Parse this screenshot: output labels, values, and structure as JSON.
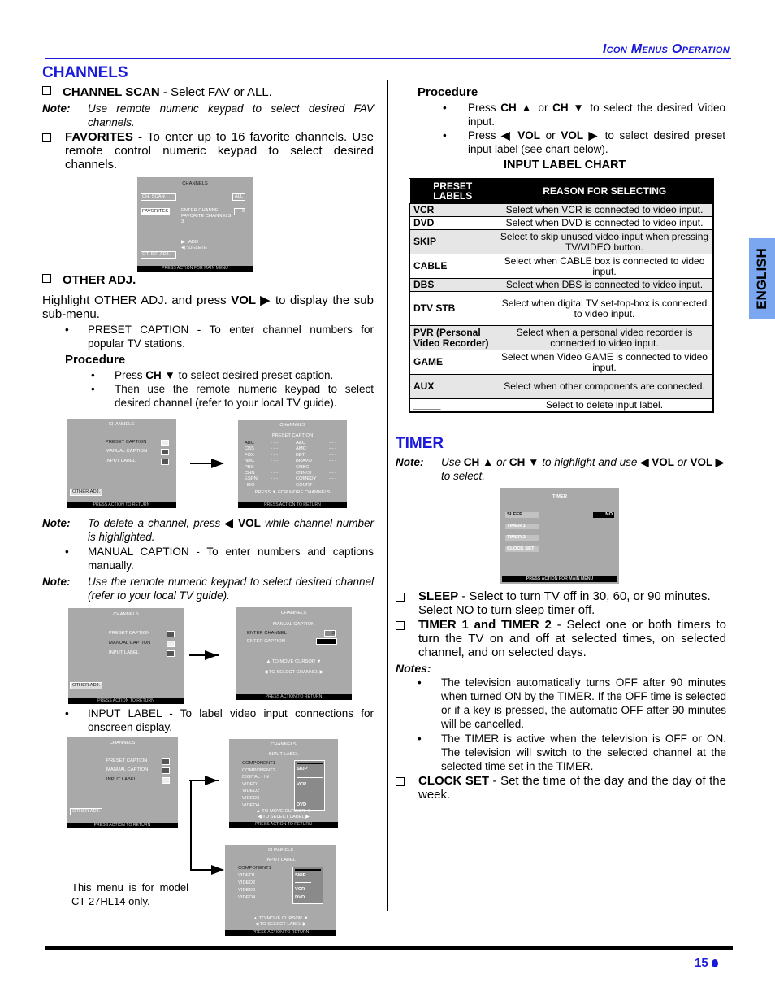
{
  "header": {
    "title": "Icon Menus Operation",
    "side_tab": "ENGLISH"
  },
  "footer": {
    "page_number": "15"
  },
  "channels": {
    "title": "CHANNELS",
    "channel_scan": {
      "label": "CHANNEL SCAN",
      "text": " - Select FAV or ALL."
    },
    "note1": {
      "label": "Note:",
      "text": "Use remote numeric keypad to select desired FAV channels."
    },
    "favorites": {
      "label": "FAVORITES -",
      "text": " To enter up to 16 favorite channels. Use remote control numeric keypad to select desired channels."
    },
    "fav_screen": {
      "title": "CHANNELS",
      "items": [
        "CH. SCAN",
        "FAVORITES",
        "OTHER ADJ."
      ],
      "scan_value": "ALL",
      "enter_channel": "ENTER CHANNEL",
      "enter_value": "3",
      "favorite_channels": "FAVORITE CHANNELS",
      "favorite_value": "3",
      "add": "▶ : ADD",
      "delete": "◀ : DELETE",
      "footer": "PRESS ACTION FOR MAIN MENU"
    },
    "other_adj": {
      "label": "OTHER ADJ.",
      "intro_a": "Highlight OTHER ADJ. and press ",
      "intro_b": "VOL ▶",
      "intro_c": " to display the sub sub-menu.",
      "preset_bullet": "PRESET CAPTION - To enter channel numbers for popular TV stations.",
      "procedure_title": "Procedure",
      "procedure_1a": "Press ",
      "procedure_1b": "CH ▼",
      "procedure_1c": " to select desired preset caption.",
      "procedure_2": "Then use the remote numeric keypad to select desired channel (refer to your local TV guide)."
    },
    "submenu_screen": {
      "title": "CHANNELS",
      "items": [
        "PRESET CAPTION",
        "MANUAL CAPTION",
        "INPUT LABEL"
      ],
      "other_adj": "OTHER ADJ.",
      "footer": "PRESS ACTION TO RETURN"
    },
    "preset_screen": {
      "title": "CHANNELS",
      "subtitle": "PRESET CAPTION",
      "left": [
        "ABC",
        "CBS",
        "FOX",
        "NBC",
        "PBS",
        "CNN",
        "ESPN",
        "HBO"
      ],
      "right": [
        "A&C",
        "AMC",
        "BET",
        "BRAVO",
        "CNBC",
        "CNN/SI",
        "COMEDY",
        "COURT"
      ],
      "dash": "- - -",
      "more": "PRESS ▼ FOR MORE CHANNELS",
      "footer": "PRESS ACTION TO RETURN"
    },
    "note2": {
      "label": "Note:",
      "a": "To delete a channel, press ",
      "b": "◀ VOL",
      "c": " while channel number is highlighted."
    },
    "manual_bullet": "MANUAL CAPTION - To enter numbers and captions manually.",
    "note3": {
      "label": "Note:",
      "text": "Use the remote numeric keypad to select desired channel (refer to your local TV guide)."
    },
    "manual_screen": {
      "title": "CHANNELS",
      "subtitle": "MANUAL CAPTION",
      "enter_channel": "ENTER CHANNEL",
      "channel_value": "3",
      "enter_caption": "ENTER CAPTION",
      "caption_value": "- - - -",
      "move": "▲ TO MOVE CURSOR ▼",
      "select": "◀ TO SELECT CHANNEL ▶",
      "footer": "PRESS ACTION TO RETURN"
    },
    "input_bullet": "INPUT LABEL - To label video input connections for onscreen display.",
    "input_screen": {
      "title": "CHANNELS",
      "subtitle": "INPUT LABEL",
      "inputs": [
        "COMPONENT1",
        "COMPONENT2",
        "DIGITAL - IN",
        "VIDEO1",
        "VIDEO2",
        "VIDEO3",
        "VIDEO4"
      ],
      "options": [
        "SKIP",
        "VCR",
        "DVD"
      ],
      "move": "▲ TO MOVE CURSOR ▼",
      "select": "◀ TO SELECT LABEL ▶",
      "footer": "PRESS ACTION TO RETURN"
    },
    "model_screen": {
      "title": "CHANNELS",
      "subtitle": "INPUT LABEL",
      "inputs": [
        "COMPONENT1",
        "VIDEO1",
        "VIDEO2",
        "VIDEO3",
        "VIDEO4"
      ],
      "options": [
        "SKIP",
        "VCR",
        "DVD"
      ],
      "move": "▲ TO MOVE CURSOR ▼",
      "select": "◀ TO SELECT LABEL ▶",
      "footer": "PRESS ACTION TO RETURN"
    },
    "model_note": "This menu is for model CT-27HL14 only."
  },
  "right": {
    "procedure_title": "Procedure",
    "p1a": "Press ",
    "p1b": "CH ▲",
    "p1c": " or ",
    "p1d": "CH ▼",
    "p1e": " to select the desired Video input.",
    "p2a": "Press ",
    "p2b": "◀ VOL",
    "p2c": " or ",
    "p2d": "VOL ▶",
    "p2e": " to select desired preset input label (see chart below).",
    "chart_title": "INPUT LABEL CHART",
    "chart": {
      "headers": [
        "PRESET LABELS",
        "REASON FOR SELECTING"
      ],
      "rows": [
        {
          "label": "VCR",
          "reason": "Select when VCR is connected to video input."
        },
        {
          "label": "DVD",
          "reason": "Select when DVD is connected to video input."
        },
        {
          "label": "SKIP",
          "reason": "Select to skip unused video input when pressing TV/VIDEO button."
        },
        {
          "label": "CABLE",
          "reason": "Select when CABLE box is connected to video input."
        },
        {
          "label": "DBS",
          "reason": "Select when DBS is connected to video input."
        },
        {
          "label": "DTV STB",
          "reason": "Select when digital TV set-top-box is connected to video input."
        },
        {
          "label": "PVR  (Personal Video Recorder)",
          "reason": "Select when a personal video recorder is connected to video input."
        },
        {
          "label": "GAME",
          "reason": "Select when Video GAME is connected to video input."
        },
        {
          "label": "AUX",
          "reason": "Select when other components are connected."
        },
        {
          "label": "_____",
          "reason": "Select to delete input label."
        }
      ]
    }
  },
  "timer": {
    "title": "TIMER",
    "note": {
      "label": "Note:",
      "a": "Use ",
      "b": "CH ▲",
      "c": " or ",
      "d": "CH ▼",
      "e": " to highlight and use ",
      "f": "◀ VOL",
      "g": " or ",
      "h": "VOL ▶",
      "i": " to select."
    },
    "screen": {
      "title": "TIMER",
      "items": [
        "SLEEP",
        "TIMER 1",
        "TIMER 2",
        "CLOCK SET"
      ],
      "sleep_value": "NO",
      "footer": "PRESS ACTION FOR MAIN MENU"
    },
    "sleep": {
      "label": "SLEEP",
      "text": " - Select to turn TV off in 30, 60, or 90 minutes. Select NO to turn sleep timer off."
    },
    "timers": {
      "label": "TIMER 1 and TIMER 2",
      "text": " - Select one or both timers to turn the TV on and off at selected times, on selected channel, and on selected days."
    },
    "notes_label": "Notes:",
    "notes": [
      "The television automatically turns OFF after 90 minutes when turned ON by the TIMER. If the OFF time is selected or if a key is pressed, the automatic OFF after 90 minutes will be cancelled.",
      "The TIMER is active when the television is OFF or ON. The television will switch to the selected channel at the selected time set in the TIMER."
    ],
    "clock": {
      "label": "CLOCK SET",
      "text": " - Set the time of the day and the day of the week."
    }
  }
}
